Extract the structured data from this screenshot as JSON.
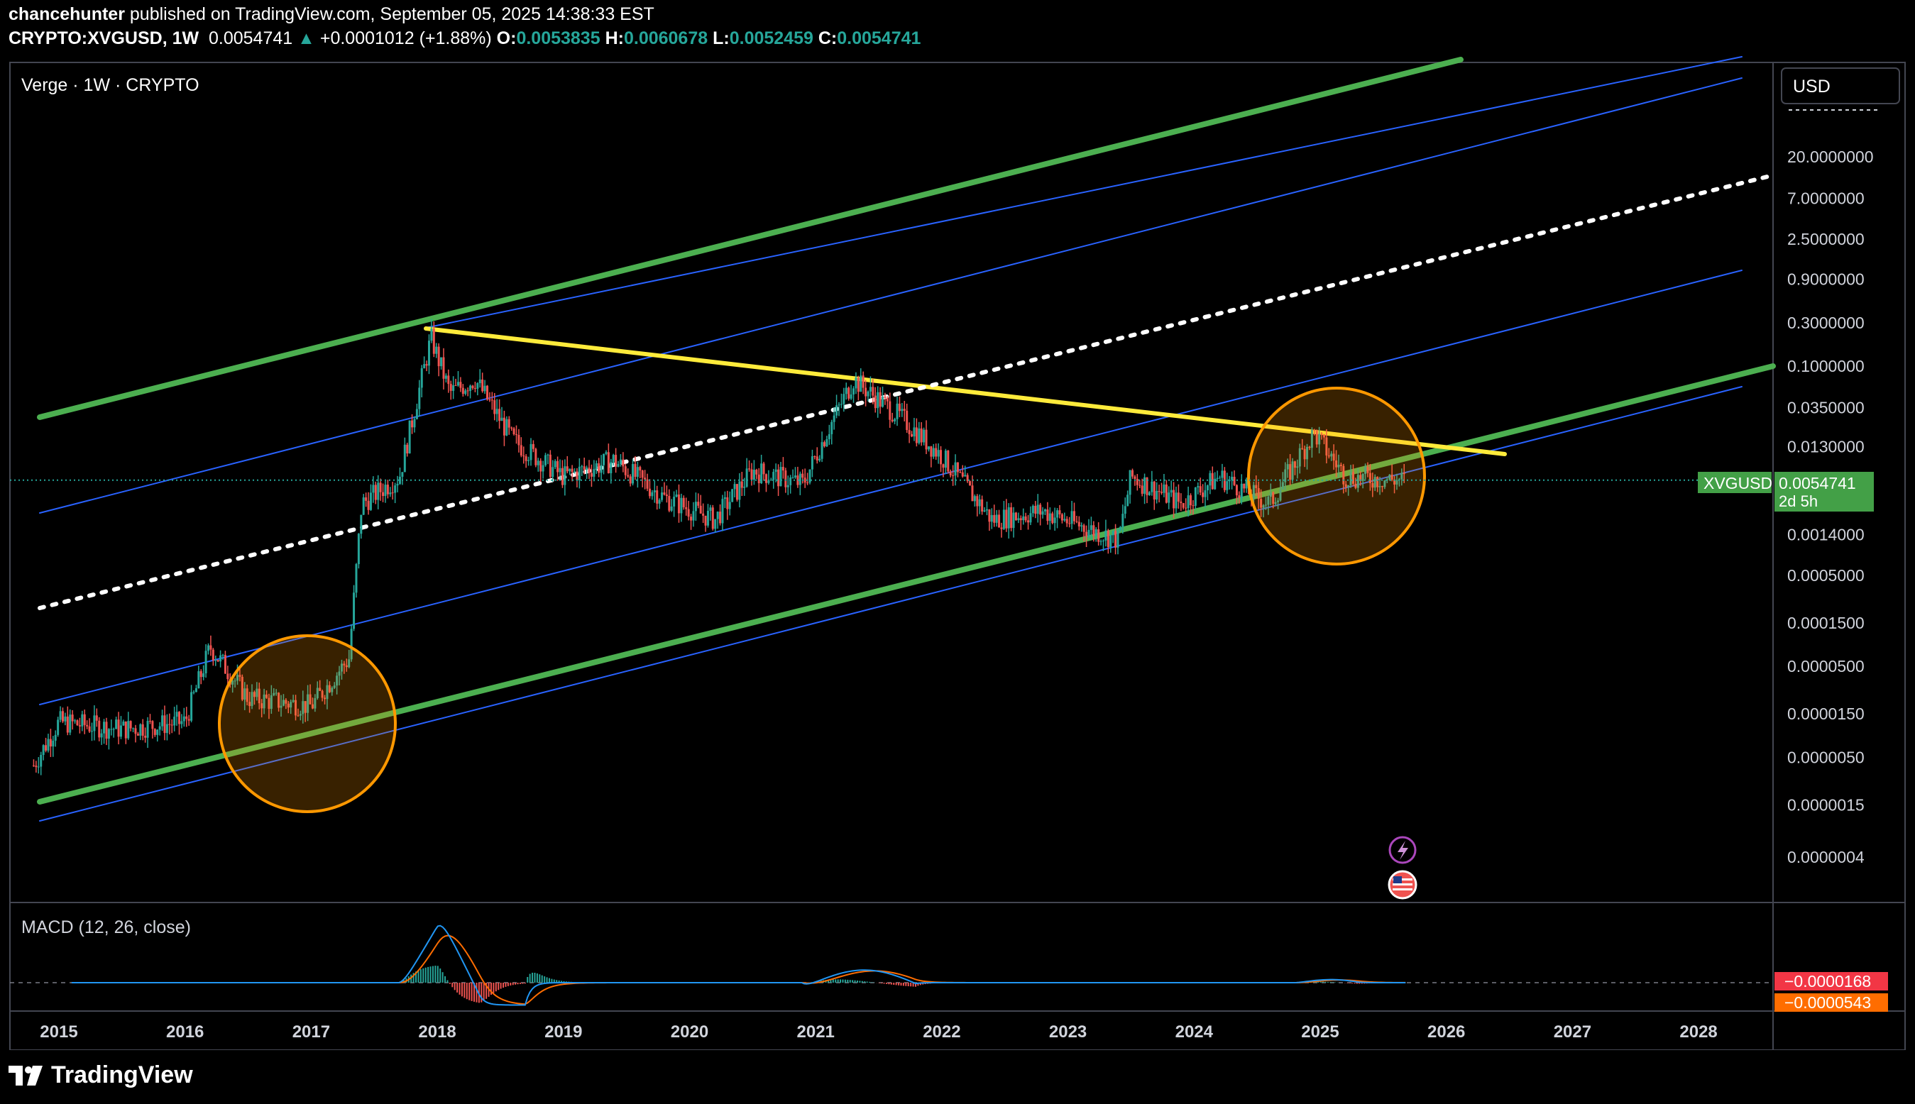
{
  "header": {
    "author": "chancehunter",
    "published_text": "published on TradingView.com, September 05, 2025 14:38:33 EST",
    "symbol": "CRYPTO:XVGUSD, 1W",
    "last": "0.0054741",
    "change": "+0.0001012 (+1.88%)",
    "o_label": "O:",
    "o": "0.0053835",
    "h_label": "H:",
    "h": "0.0060678",
    "l_label": "L:",
    "l": "0.0052459",
    "c_label": "C:",
    "c": "0.0054741"
  },
  "pane_title": "Verge · 1W · CRYPTO",
  "currency": "USD",
  "price_tag": {
    "symbol": "XVGUSD",
    "value": "0.0054741",
    "countdown": "2d 5h"
  },
  "macd": {
    "title": "MACD (12, 26, close)",
    "value1": "−0.0000168",
    "value2": "−0.0000543"
  },
  "branding": "TradingView",
  "colors": {
    "green_channel": "#4caf50",
    "blue_channel": "#2962ff",
    "yellow_line": "#ffeb3b",
    "circle": "#ff9800",
    "up": "#26a69a",
    "down": "#ef5350",
    "macd_line": "#2196f3",
    "signal_line": "#ff6d00"
  },
  "chart_data": {
    "type": "candlestick",
    "y_scale": "log",
    "y_ticks": [
      "20.0000000",
      "7.0000000",
      "2.5000000",
      "0.9000000",
      "0.3000000",
      "0.1000000",
      "0.0350000",
      "0.0130000",
      "0.0014000",
      "0.0005000",
      "0.0001500",
      "0.0000500",
      "0.0000150",
      "0.0000050",
      "0.0000015",
      "0.0000004"
    ],
    "x_ticks": [
      "2015",
      "2016",
      "2017",
      "2018",
      "2019",
      "2020",
      "2021",
      "2022",
      "2023",
      "2024",
      "2025",
      "2026",
      "2027",
      "2028"
    ],
    "price_series": [
      {
        "t": 2014.8,
        "p": 4e-06
      },
      {
        "t": 2015.0,
        "p": 1.2e-05
      },
      {
        "t": 2015.5,
        "p": 1e-05
      },
      {
        "t": 2016.0,
        "p": 1.2e-05
      },
      {
        "t": 2016.2,
        "p": 8e-05
      },
      {
        "t": 2016.5,
        "p": 2.2e-05
      },
      {
        "t": 2017.0,
        "p": 1.8e-05
      },
      {
        "t": 2017.3,
        "p": 6e-05
      },
      {
        "t": 2017.4,
        "p": 0.003
      },
      {
        "t": 2017.7,
        "p": 0.006
      },
      {
        "t": 2017.95,
        "p": 0.2
      },
      {
        "t": 2018.1,
        "p": 0.05
      },
      {
        "t": 2018.3,
        "p": 0.07
      },
      {
        "t": 2018.6,
        "p": 0.015
      },
      {
        "t": 2019.0,
        "p": 0.006
      },
      {
        "t": 2019.4,
        "p": 0.009
      },
      {
        "t": 2019.8,
        "p": 0.0035
      },
      {
        "t": 2020.2,
        "p": 0.002
      },
      {
        "t": 2020.5,
        "p": 0.007
      },
      {
        "t": 2020.9,
        "p": 0.005
      },
      {
        "t": 2021.1,
        "p": 0.02
      },
      {
        "t": 2021.3,
        "p": 0.07
      },
      {
        "t": 2021.7,
        "p": 0.025
      },
      {
        "t": 2022.0,
        "p": 0.01
      },
      {
        "t": 2022.4,
        "p": 0.002
      },
      {
        "t": 2022.8,
        "p": 0.0025
      },
      {
        "t": 2023.4,
        "p": 0.0012
      },
      {
        "t": 2023.5,
        "p": 0.006
      },
      {
        "t": 2023.9,
        "p": 0.003
      },
      {
        "t": 2024.2,
        "p": 0.006
      },
      {
        "t": 2024.6,
        "p": 0.003
      },
      {
        "t": 2024.95,
        "p": 0.018
      },
      {
        "t": 2025.2,
        "p": 0.006
      },
      {
        "t": 2025.6,
        "p": 0.0055
      },
      {
        "t": 2025.68,
        "p": 0.0054741
      }
    ],
    "current_price": 0.0054741
  }
}
